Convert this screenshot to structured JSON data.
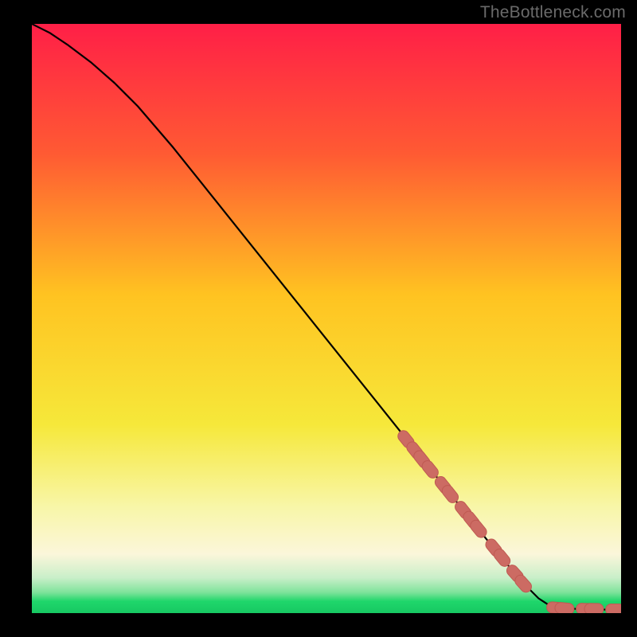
{
  "watermark": "TheBottleneck.com",
  "colors": {
    "top": "#ff1f47",
    "upper_mid": "#ff6a2a",
    "mid": "#ffc321",
    "lower_mid": "#f6e83a",
    "pale": "#f8f6a8",
    "cream": "#fbf6da",
    "green_light": "#7ee39a",
    "green": "#1fd66b",
    "line": "#000000",
    "marker": "#cc6b63",
    "marker_edge": "#bf5a52"
  },
  "chart_data": {
    "type": "line",
    "title": "",
    "xlabel": "",
    "ylabel": "",
    "xlim": [
      0,
      100
    ],
    "ylim": [
      0,
      100
    ],
    "grid": false,
    "legend": false,
    "series": [
      {
        "name": "curve",
        "x": [
          0,
          3,
          6,
          10,
          14,
          18,
          24,
          30,
          36,
          42,
          48,
          54,
          60,
          66,
          72,
          78,
          83,
          86,
          88,
          90,
          93,
          96,
          99
        ],
        "y": [
          100,
          98.5,
          96.5,
          93.5,
          90,
          86,
          79,
          71.5,
          64,
          56.5,
          49,
          41.5,
          34,
          26.5,
          19,
          11.5,
          5.5,
          2.5,
          1.2,
          0.8,
          0.7,
          0.6,
          0.6
        ]
      }
    ],
    "markers": [
      {
        "x": 63.5,
        "y": 29.5
      },
      {
        "x": 65.0,
        "y": 27.6
      },
      {
        "x": 66.2,
        "y": 26.1
      },
      {
        "x": 67.6,
        "y": 24.4
      },
      {
        "x": 69.8,
        "y": 21.7
      },
      {
        "x": 71.0,
        "y": 20.2
      },
      {
        "x": 73.2,
        "y": 17.5
      },
      {
        "x": 74.6,
        "y": 15.8
      },
      {
        "x": 75.8,
        "y": 14.3
      },
      {
        "x": 78.4,
        "y": 11.1
      },
      {
        "x": 79.8,
        "y": 9.4
      },
      {
        "x": 82.0,
        "y": 6.7
      },
      {
        "x": 83.4,
        "y": 5.0
      },
      {
        "x": 89.0,
        "y": 0.9
      },
      {
        "x": 90.4,
        "y": 0.8
      },
      {
        "x": 94.0,
        "y": 0.7
      },
      {
        "x": 95.4,
        "y": 0.7
      },
      {
        "x": 99.0,
        "y": 0.6
      }
    ]
  }
}
